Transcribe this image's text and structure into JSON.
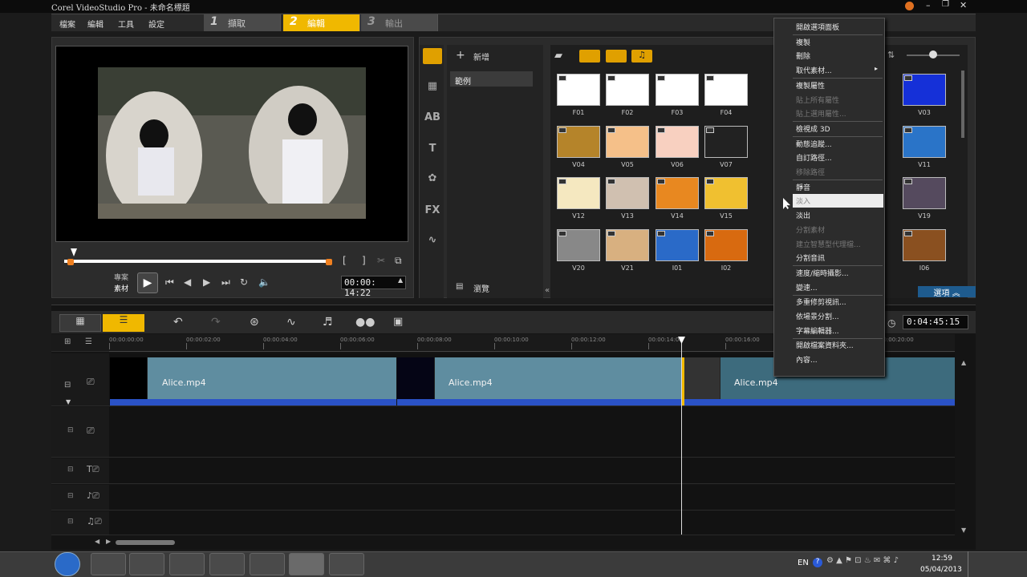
{
  "title": "Corel VideoStudio Pro - 未命名標題",
  "menu": [
    "檔案",
    "編輯",
    "工具",
    "設定"
  ],
  "steps": [
    {
      "num": "1",
      "label": "擷取"
    },
    {
      "num": "2",
      "label": "編輯"
    },
    {
      "num": "3",
      "label": "輸出"
    }
  ],
  "preview": {
    "mode_project": "專案",
    "mode_clip": "素材",
    "timecode": "00:00: 14:22",
    "mark_in": "[",
    "mark_out": "]"
  },
  "library": {
    "add_label": "新增",
    "folder": "範例",
    "browse_label": "瀏覽",
    "options_label": "選項",
    "thumbs": [
      {
        "label": "F01",
        "color": "#fff"
      },
      {
        "label": "F02",
        "color": "#fff"
      },
      {
        "label": "F03",
        "color": "#fff"
      },
      {
        "label": "F04",
        "color": "#fff"
      },
      {
        "label": "V03",
        "color": "#1530d8"
      },
      {
        "label": "V04",
        "color": "#b5842a"
      },
      {
        "label": "V05",
        "color": "#f5c089"
      },
      {
        "label": "V06",
        "color": "#f8d0c0"
      },
      {
        "label": "V07",
        "color": "#222"
      },
      {
        "label": "V11",
        "color": "#2a74c8"
      },
      {
        "label": "V12",
        "color": "#f5e8c0"
      },
      {
        "label": "V13",
        "color": "#d0c0b0"
      },
      {
        "label": "V14",
        "color": "#e88820"
      },
      {
        "label": "V15",
        "color": "#f0c030"
      },
      {
        "label": "V19",
        "color": "#554a5e"
      },
      {
        "label": "V20",
        "color": "#888"
      },
      {
        "label": "V21",
        "color": "#d8b080"
      },
      {
        "label": "I01",
        "color": "#2a6ac8"
      },
      {
        "label": "I02",
        "color": "#d86a10"
      },
      {
        "label": "I06",
        "color": "#8a5020"
      }
    ]
  },
  "timeline": {
    "duration": "0:04:45:15",
    "ticks": [
      "00:00:00:00",
      "00:00:02:00",
      "00:00:04:00",
      "00:00:06:00",
      "00:00:08:00",
      "00:00:10:00",
      "00:00:12:00",
      "00:00:14:00",
      "00:00:16:00",
      "00:00:20:00"
    ],
    "clips": [
      {
        "name": "Alice.mp4"
      },
      {
        "name": "Alice.mp4"
      },
      {
        "name": "Alice.mp4"
      }
    ]
  },
  "context_menu": [
    {
      "label": "開啟選項面板",
      "state": "normal"
    },
    {
      "label": "複製",
      "state": "normal"
    },
    {
      "label": "刪除",
      "state": "normal"
    },
    {
      "label": "取代素材...",
      "state": "normal",
      "sub": true
    },
    {
      "label": "複製屬性",
      "state": "normal"
    },
    {
      "label": "貼上所有屬性",
      "state": "disabled"
    },
    {
      "label": "貼上選用屬性...",
      "state": "disabled"
    },
    {
      "label": "檢視成 3D",
      "state": "normal"
    },
    {
      "label": "動態追蹤...",
      "state": "normal"
    },
    {
      "label": "自訂路徑...",
      "state": "normal"
    },
    {
      "label": "移除路徑",
      "state": "disabled"
    },
    {
      "label": "靜音",
      "state": "normal"
    },
    {
      "label": "淡入",
      "state": "highlight"
    },
    {
      "label": "淡出",
      "state": "normal"
    },
    {
      "label": "分割素材",
      "state": "disabled"
    },
    {
      "label": "建立智慧型代理檔...",
      "state": "disabled"
    },
    {
      "label": "分割音訊",
      "state": "normal"
    },
    {
      "label": "速度/縮時攝影...",
      "state": "normal"
    },
    {
      "label": "變速...",
      "state": "normal"
    },
    {
      "label": "多重修剪視訊...",
      "state": "normal"
    },
    {
      "label": "依場景分割...",
      "state": "normal"
    },
    {
      "label": "字幕編輯器...",
      "state": "normal"
    },
    {
      "label": "開啟檔案資料夾...",
      "state": "normal"
    },
    {
      "label": "內容...",
      "state": "normal"
    }
  ],
  "taskbar": {
    "lang": "EN",
    "time": "12:59",
    "date": "05/04/2013"
  }
}
